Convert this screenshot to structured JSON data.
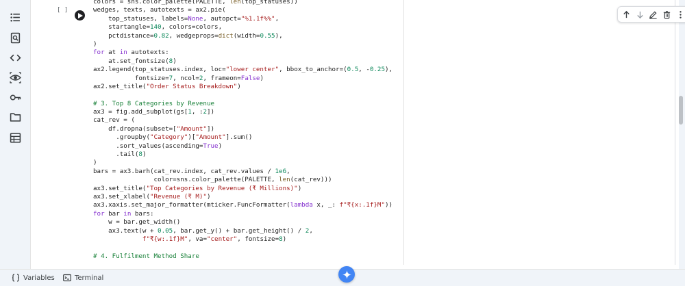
{
  "sidebar": {
    "items": [
      {
        "icon": "table-of-contents-icon"
      },
      {
        "icon": "find-replace-icon"
      },
      {
        "icon": "code-snippets-icon"
      },
      {
        "icon": "variables-inspector-icon"
      },
      {
        "icon": "secrets-key-icon"
      },
      {
        "icon": "files-folder-icon"
      },
      {
        "icon": "data-table-icon"
      }
    ]
  },
  "cell": {
    "execution_count": "[ ]",
    "toolbar": [
      {
        "icon": "move-up-icon"
      },
      {
        "icon": "move-down-icon"
      },
      {
        "icon": "edit-icon"
      },
      {
        "icon": "delete-icon"
      },
      {
        "icon": "more-vert-icon"
      }
    ],
    "lines": [
      "colors = sns.color_palette(PALETTE, len(top_statuses))",
      "wedges, texts, autotexts = ax2.pie(",
      "    top_statuses, labels=None, autopct=\"%1.1f%%\",",
      "    startangle=140, colors=colors,",
      "    pctdistance=0.82, wedgeprops=dict(width=0.55),",
      ")",
      "for at in autotexts:",
      "    at.set_fontsize(8)",
      "ax2.legend(top_statuses.index, loc=\"lower center\", bbox_to_anchor=(0.5, -0.25),",
      "           fontsize=7, ncol=2, frameon=False)",
      "ax2.set_title(\"Order Status Breakdown\")",
      "",
      "# 3. Top 8 Categories by Revenue",
      "ax3 = fig.add_subplot(gs[1, :2])",
      "cat_rev = (",
      "    df.dropna(subset=[\"Amount\"])",
      "      .groupby(\"Category\")[\"Amount\"].sum()",
      "      .sort_values(ascending=True)",
      "      .tail(8)",
      ")",
      "bars = ax3.barh(cat_rev.index, cat_rev.values / 1e6,",
      "                color=sns.color_palette(PALETTE, len(cat_rev)))",
      "ax3.set_title(\"Top Categories by Revenue (₹ Millions)\")",
      "ax3.set_xlabel(\"Revenue (₹ M)\")",
      "ax3.xaxis.set_major_formatter(mticker.FuncFormatter(lambda x, _: f\"₹{x:.1f}M\"))",
      "for bar in bars:",
      "    w = bar.get_width()",
      "    ax3.text(w + 0.05, bar.get_y() + bar.get_height() / 2,",
      "             f\"₹{w:.1f}M\", va=\"center\", fontsize=8)",
      "",
      "# 4. Fulfilment Method Share"
    ]
  },
  "statusbar": {
    "variables_label": "Variables",
    "terminal_label": "Terminal"
  },
  "colors": {
    "keyword": "#8430ce",
    "string": "#a61d1d",
    "number": "#098658",
    "comment": "#188038",
    "accent": "#4285f4"
  }
}
